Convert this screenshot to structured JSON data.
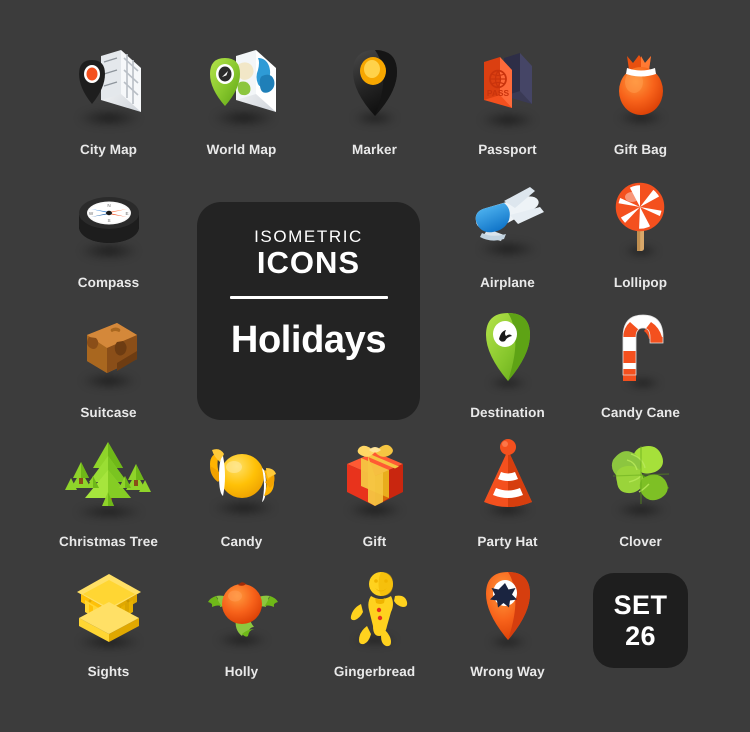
{
  "poster": {
    "background_color": "#3c3c3c",
    "label_color": "#e9e9e9"
  },
  "promo_card": {
    "kicker": "ISOMETRIC",
    "kicker_strong": "ICONS",
    "title": "Holidays",
    "background_color": "#232323"
  },
  "set_badge": {
    "word": "SET",
    "number": "26",
    "background_color": "#1e1e1e"
  },
  "icons": [
    {
      "id": "city-map",
      "label": "City Map",
      "icon": "city-map-icon",
      "col": 1,
      "row": 1,
      "colors": [
        "#ffffff",
        "#c9ccd1",
        "#1a1a1a",
        "#f4501e"
      ]
    },
    {
      "id": "world-map",
      "label": "World Map",
      "icon": "world-map-icon",
      "col": 2,
      "row": 1,
      "colors": [
        "#8cc63f",
        "#2e9bd6",
        "#f2e7c7",
        "#ffffff"
      ]
    },
    {
      "id": "marker",
      "label": "Marker",
      "icon": "marker-icon",
      "col": 3,
      "row": 1,
      "colors": [
        "#2b2b2b",
        "#f7a700",
        "#ffd24a"
      ]
    },
    {
      "id": "passport",
      "label": "Passport",
      "icon": "passport-icon",
      "col": 4,
      "row": 1,
      "colors": [
        "#f4501e",
        "#3a3a55"
      ],
      "text": "PASS"
    },
    {
      "id": "gift-bag",
      "label": "Gift Bag",
      "icon": "gift-bag-icon",
      "col": 5,
      "row": 1,
      "colors": [
        "#f4601a",
        "#ff8a2b",
        "#ffffff"
      ]
    },
    {
      "id": "compass",
      "label": "Compass",
      "icon": "compass-icon",
      "col": 1,
      "row": 2,
      "colors": [
        "#1c1c1c",
        "#ffffff",
        "#2f7fd4",
        "#f4501e"
      ]
    },
    {
      "id": "airplane",
      "label": "Airplane",
      "icon": "airplane-icon",
      "col": 4,
      "row": 2,
      "colors": [
        "#eef3f7",
        "#2196f3",
        "#c8d6e0"
      ]
    },
    {
      "id": "lollipop",
      "label": "Lollipop",
      "icon": "lollipop-icon",
      "col": 5,
      "row": 2,
      "colors": [
        "#f4501e",
        "#ffffff",
        "#d9a86a"
      ]
    },
    {
      "id": "suitcase",
      "label": "Suitcase",
      "icon": "suitcase-icon",
      "col": 1,
      "row": 3,
      "colors": [
        "#c1762a",
        "#8a4e18",
        "#6d3c12"
      ]
    },
    {
      "id": "destination",
      "label": "Destination",
      "icon": "destination-icon",
      "col": 4,
      "row": 3,
      "colors": [
        "#8cc63f",
        "#ffffff",
        "#1a1a1a"
      ]
    },
    {
      "id": "candy-cane",
      "label": "Candy Cane",
      "icon": "candy-cane-icon",
      "col": 5,
      "row": 3,
      "colors": [
        "#f4501e",
        "#ffffff"
      ]
    },
    {
      "id": "christmas-tree",
      "label": "Christmas Tree",
      "icon": "christmas-tree-icon",
      "col": 1,
      "row": 4,
      "colors": [
        "#7ec820",
        "#4f9b12",
        "#8a4e18"
      ]
    },
    {
      "id": "candy",
      "label": "Candy",
      "icon": "candy-icon",
      "col": 2,
      "row": 4,
      "colors": [
        "#ffb300",
        "#ffd54a",
        "#ffffff"
      ]
    },
    {
      "id": "gift",
      "label": "Gift",
      "icon": "gift-icon",
      "col": 3,
      "row": 4,
      "colors": [
        "#e8331c",
        "#ff5a33",
        "#f5c542"
      ]
    },
    {
      "id": "party-hat",
      "label": "Party Hat",
      "icon": "party-hat-icon",
      "col": 4,
      "row": 4,
      "colors": [
        "#f4501e",
        "#ffffff"
      ]
    },
    {
      "id": "clover",
      "label": "Clover",
      "icon": "clover-icon",
      "col": 5,
      "row": 4,
      "colors": [
        "#8cc63f",
        "#b6e04a",
        "#4f9b12"
      ]
    },
    {
      "id": "sights",
      "label": "Sights",
      "icon": "sights-icon",
      "col": 1,
      "row": 5,
      "colors": [
        "#ffd633",
        "#ffc107",
        "#e0a800"
      ]
    },
    {
      "id": "holly",
      "label": "Holly",
      "icon": "holly-icon",
      "col": 2,
      "row": 5,
      "colors": [
        "#f4601a",
        "#8cc63f",
        "#4f9b12"
      ]
    },
    {
      "id": "gingerbread",
      "label": "Gingerbread",
      "icon": "gingerbread-icon",
      "col": 3,
      "row": 5,
      "colors": [
        "#ffd21e",
        "#f0b400",
        "#e8331c"
      ]
    },
    {
      "id": "wrong-way",
      "label": "Wrong Way",
      "icon": "wrong-way-icon",
      "col": 4,
      "row": 5,
      "colors": [
        "#f4501e",
        "#ffffff",
        "#1a2440"
      ]
    }
  ]
}
